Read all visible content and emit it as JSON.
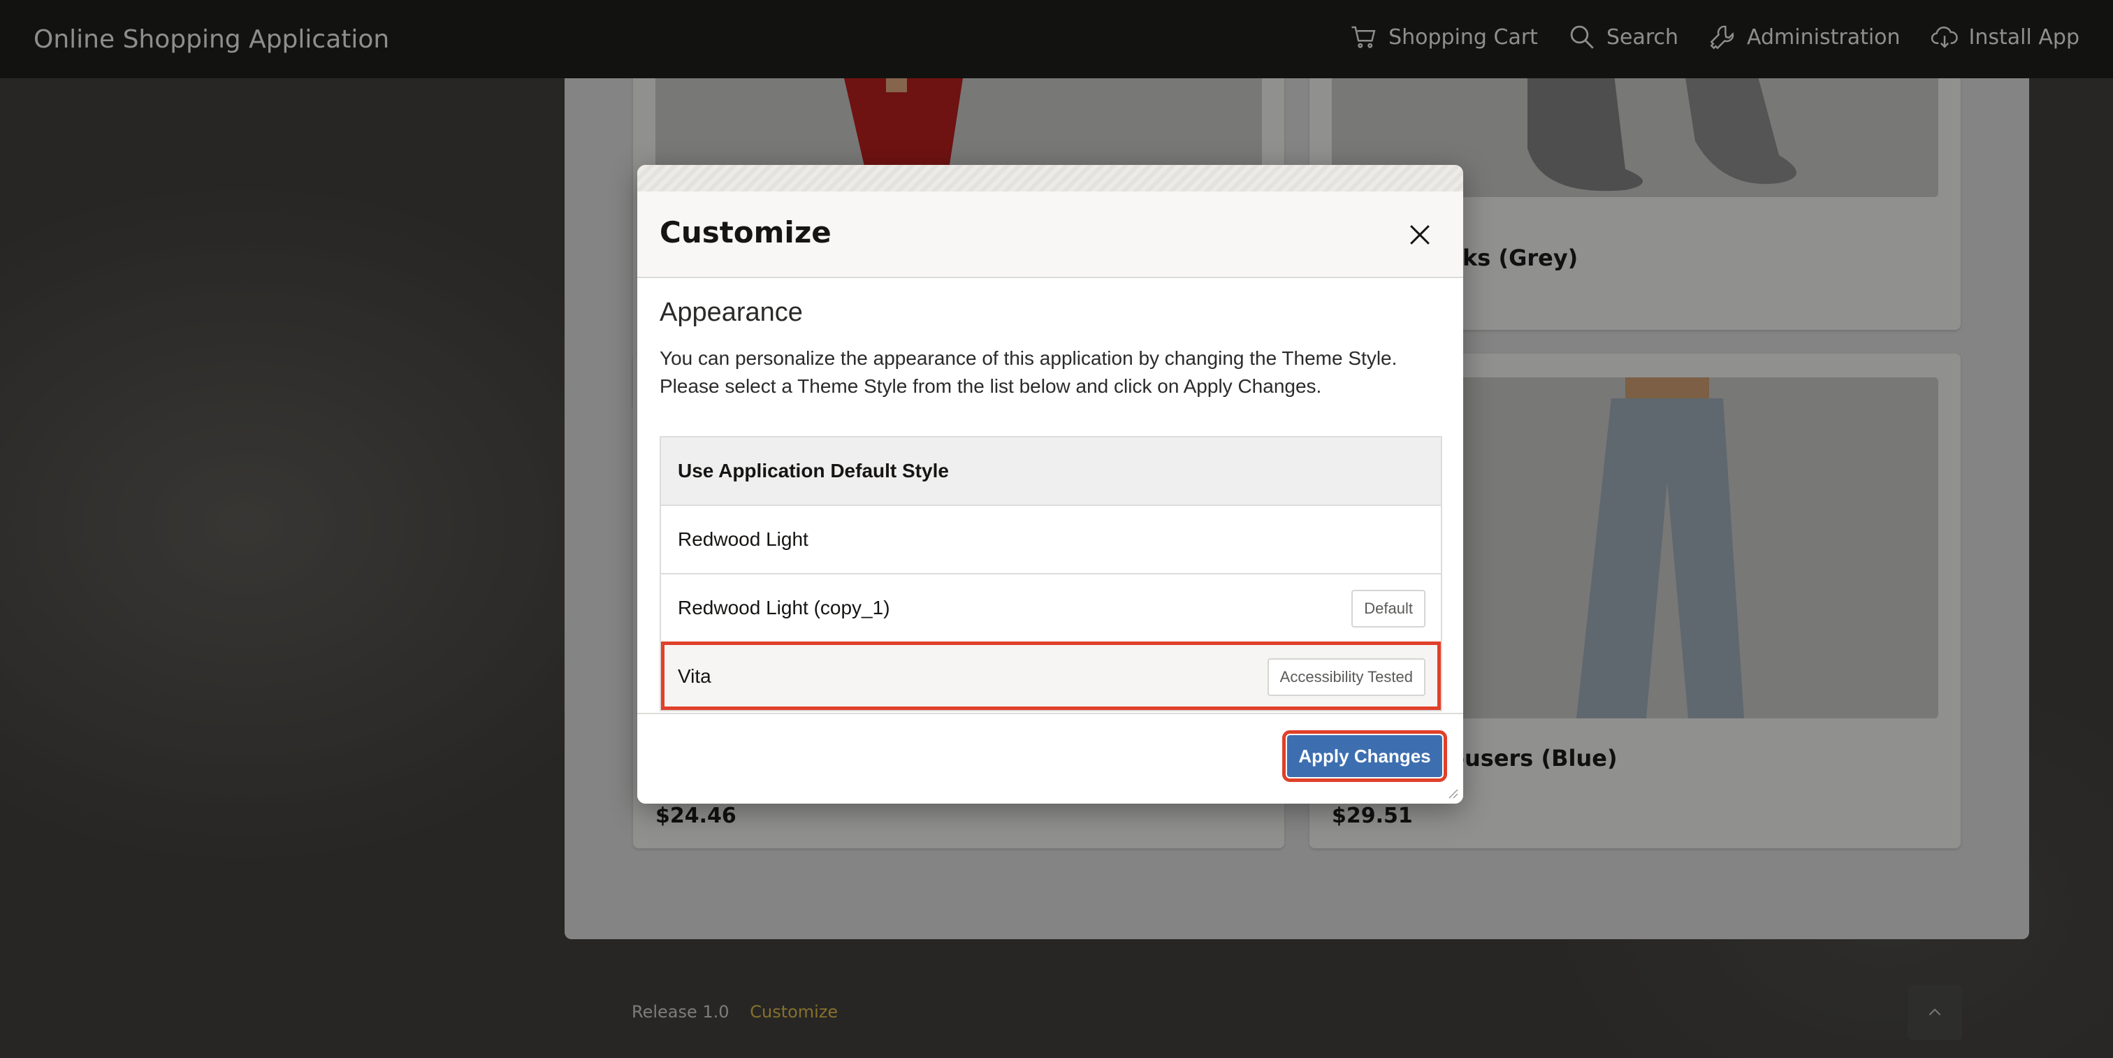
{
  "app": {
    "title": "Online Shopping Application"
  },
  "nav": [
    {
      "label": "Shopping Cart",
      "icon": "cart-icon"
    },
    {
      "label": "Search",
      "icon": "search-icon"
    },
    {
      "label": "Administration",
      "icon": "wrench-icon"
    },
    {
      "label": "Install App",
      "icon": "cloud-download-icon"
    }
  ],
  "products": [
    {
      "name": "",
      "price": "$24.46"
    },
    {
      "name": "cks (Grey)",
      "price": ""
    },
    {
      "name": "",
      "price": ""
    },
    {
      "name": "ousers (Blue)",
      "price": "$29.51"
    }
  ],
  "footer": {
    "release": "Release 1.0",
    "customize": "Customize"
  },
  "dialog": {
    "title": "Customize",
    "section_title": "Appearance",
    "description": "You can personalize the appearance of this application by changing the Theme Style. Please select a Theme Style from the list below and click on Apply Changes.",
    "styles": [
      {
        "label": "Use Application Default Style",
        "badge": ""
      },
      {
        "label": "Redwood Light",
        "badge": ""
      },
      {
        "label": "Redwood Light (copy_1)",
        "badge": "Default"
      },
      {
        "label": "Vita",
        "badge": "Accessibility Tested"
      }
    ],
    "apply_label": "Apply Changes"
  },
  "colors": {
    "accent": "#3d6fb0",
    "highlight": "#e0402a",
    "topbar": "#1e1e1c",
    "link": "#d8b54a"
  }
}
